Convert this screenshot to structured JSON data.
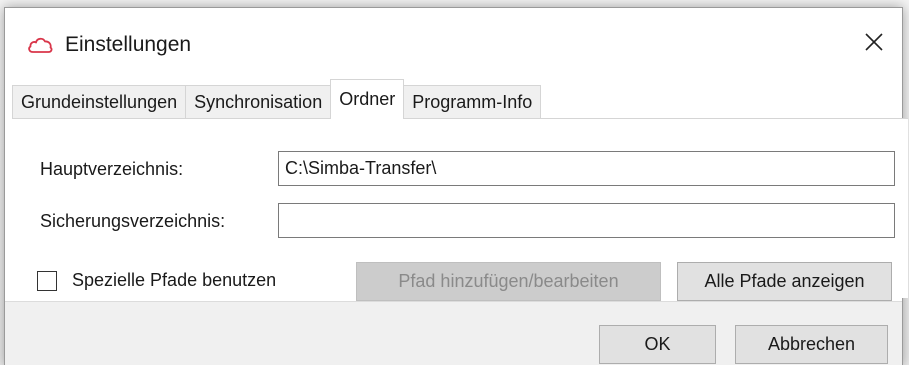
{
  "window": {
    "title": "Einstellungen",
    "icon": "cloud-outline-icon",
    "close_symbol": "✕"
  },
  "tabs": [
    {
      "label": "Grundeinstellungen",
      "active": false
    },
    {
      "label": "Synchronisation",
      "active": false
    },
    {
      "label": "Ordner",
      "active": true
    },
    {
      "label": "Programm-Info",
      "active": false
    }
  ],
  "form": {
    "main_dir_label": "Hauptverzeichnis:",
    "main_dir_value": "C:\\Simba-Transfer\\",
    "backup_dir_label": "Sicherungsverzeichnis:",
    "backup_dir_value": "",
    "special_paths_label": "Spezielle Pfade benutzen",
    "special_paths_checked": false,
    "add_edit_path_label": "Pfad hinzufügen/bearbeiten",
    "show_all_paths_label": "Alle Pfade anzeigen"
  },
  "footer": {
    "ok_label": "OK",
    "cancel_label": "Abbrechen"
  },
  "colors": {
    "icon_accent": "#d9364a",
    "disabled_button": "#cccccc"
  }
}
